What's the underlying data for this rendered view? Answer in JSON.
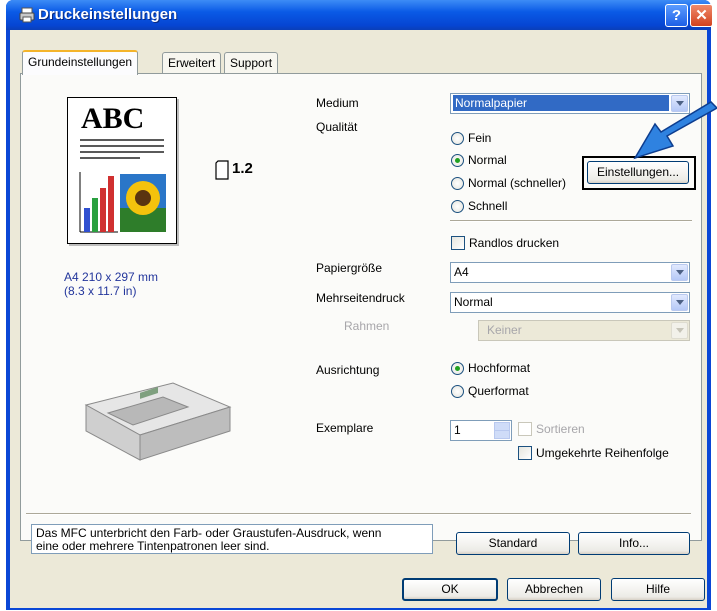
{
  "window": {
    "title": "Druckeinstellungen",
    "help_glyph": "?",
    "close_glyph": "✕"
  },
  "tabs": [
    {
      "label": "Grundeinstellungen",
      "active": true
    },
    {
      "label": "Erweitert",
      "active": false
    },
    {
      "label": "Support",
      "active": false
    }
  ],
  "preview": {
    "abc": "ABC",
    "copies_indicator": "1.2",
    "paper_size_line1": "A4 210 x 297 mm",
    "paper_size_line2": "(8.3 x 11.7 in)"
  },
  "form": {
    "medium_label": "Medium",
    "medium_value": "Normalpapier",
    "qualitaet_label": "Qualität",
    "quality_options": [
      "Fein",
      "Normal",
      "Normal (schneller)",
      "Schnell"
    ],
    "quality_selected": "Normal",
    "einstellungen_button": "Einstellungen...",
    "randlos_label": "Randlos drucken",
    "papiergroesse_label": "Papiergröße",
    "papiergroesse_value": "A4",
    "mehrseitendruck_label": "Mehrseitendruck",
    "mehrseitendruck_value": "Normal",
    "rahmen_label": "Rahmen",
    "rahmen_value": "Keiner",
    "ausrichtung_label": "Ausrichtung",
    "orientation_options": [
      "Hochformat",
      "Querformat"
    ],
    "orientation_selected": "Hochformat",
    "exemplare_label": "Exemplare",
    "exemplare_value": "1",
    "sortieren_label": "Sortieren",
    "umgekehrt_label": "Umgekehrte Reihenfolge"
  },
  "status": {
    "message_line1": "Das MFC unterbricht den Farb- oder Graustufen-Ausdruck, wenn",
    "message_line2": "eine oder mehrere Tintenpatronen leer sind."
  },
  "buttons": {
    "standard": "Standard",
    "info": "Info...",
    "ok": "OK",
    "abbrechen": "Abbrechen",
    "hilfe": "Hilfe"
  },
  "colors": {
    "titlebar": "#0a5ae6",
    "selected_combo": "#316ac5",
    "annotation_arrow": "#1d6fd0"
  }
}
